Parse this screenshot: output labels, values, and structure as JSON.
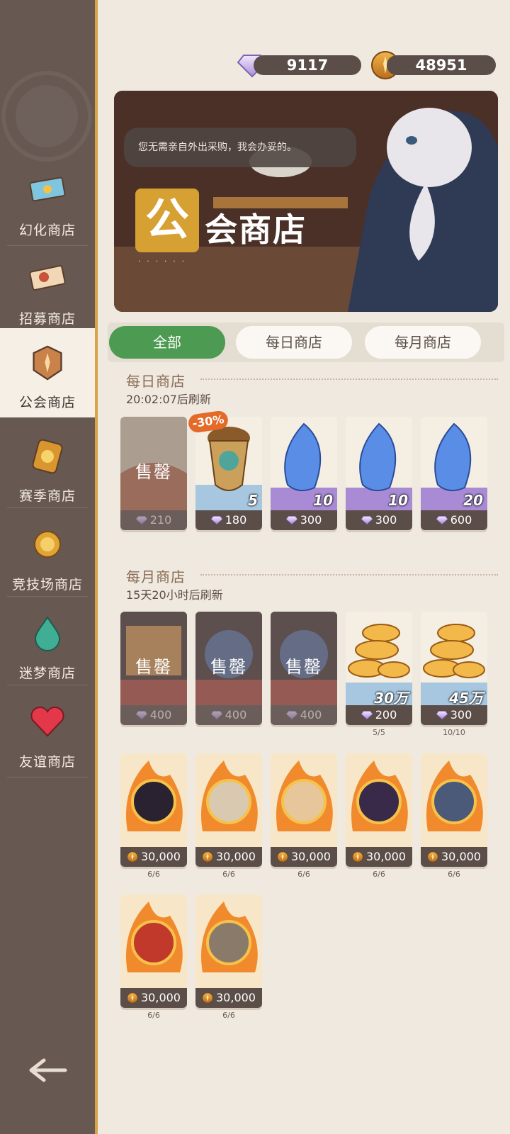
{
  "sidebar": {
    "items": [
      {
        "label": "幻化商店",
        "icon": "ticket-icon"
      },
      {
        "label": "招募商店",
        "icon": "recruit-ticket-icon"
      },
      {
        "label": "公会商店",
        "icon": "guild-emblem-icon",
        "active": true
      },
      {
        "label": "赛季商店",
        "icon": "season-token-icon"
      },
      {
        "label": "竞技场商店",
        "icon": "arena-coin-icon"
      },
      {
        "label": "迷梦商店",
        "icon": "dream-drop-icon"
      },
      {
        "label": "友谊商店",
        "icon": "heart-gem-icon"
      }
    ],
    "back_icon": "back-arrow-icon"
  },
  "currency": {
    "diamonds": "9117",
    "guild_coins": "48951"
  },
  "banner": {
    "speech": "您无需亲自外出采购，我会办妥的。",
    "title_char": "公",
    "title_rest": "会商店",
    "dots": "· · · · · ·"
  },
  "tabs": [
    {
      "label": "全部",
      "active": true
    },
    {
      "label": "每日商店",
      "active": false
    },
    {
      "label": "每月商店",
      "active": false
    }
  ],
  "daily": {
    "title": "每日商店",
    "refresh": "20:02:07后刷新",
    "items": [
      {
        "price": "210",
        "sold": true,
        "sold_label": "售罄"
      },
      {
        "price": "180",
        "qty": "5",
        "discount": "-30%"
      },
      {
        "price": "300",
        "qty": "10"
      },
      {
        "price": "300",
        "qty": "10"
      },
      {
        "price": "600",
        "qty": "20"
      }
    ]
  },
  "monthly": {
    "title": "每月商店",
    "refresh": "15天20小时后刷新",
    "items": [
      {
        "price": "400",
        "sold": true,
        "sold_label": "售罄"
      },
      {
        "price": "400",
        "sold": true,
        "sold_label": "售罄"
      },
      {
        "price": "400",
        "sold": true,
        "sold_label": "售罄"
      },
      {
        "price": "200",
        "qty": "30万",
        "limit": "5/5"
      },
      {
        "price": "300",
        "qty": "45万",
        "limit": "10/10"
      }
    ],
    "heroes": [
      {
        "price": "30,000",
        "limit": "6/6"
      },
      {
        "price": "30,000",
        "limit": "6/6"
      },
      {
        "price": "30,000",
        "limit": "6/6"
      },
      {
        "price": "30,000",
        "limit": "6/6"
      },
      {
        "price": "30,000",
        "limit": "6/6"
      },
      {
        "price": "30,000",
        "limit": "6/6"
      },
      {
        "price": "30,000",
        "limit": "6/6"
      }
    ]
  },
  "colors": {
    "accent_green": "#4d9a52",
    "sidebar": "#675852",
    "gold": "#d8a447"
  }
}
